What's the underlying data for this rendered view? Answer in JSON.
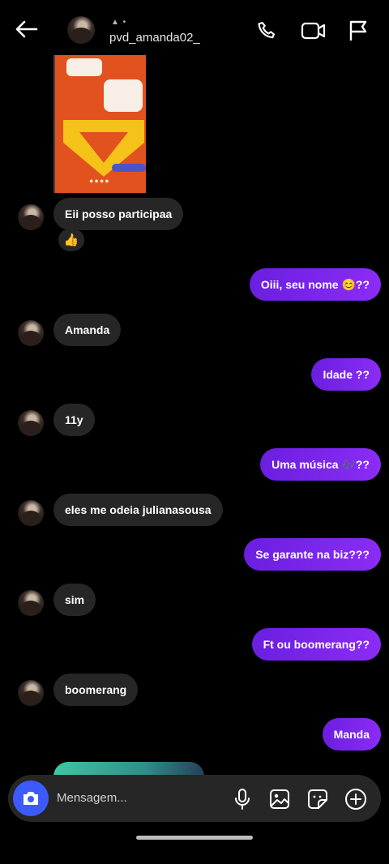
{
  "header": {
    "username": "pvd_amanda02_",
    "back_icon": "arrow-left-icon",
    "call_icon": "phone-icon",
    "video_icon": "video-camera-icon",
    "report_icon": "flag-icon"
  },
  "messages": [
    {
      "side": "in",
      "text": "Eii posso participaa",
      "reaction": "👍"
    },
    {
      "side": "out",
      "text": "Oiii, seu nome 😊??"
    },
    {
      "side": "in",
      "text": "Amanda"
    },
    {
      "side": "out",
      "text": "Idade ??"
    },
    {
      "side": "in",
      "text": "11y"
    },
    {
      "side": "out",
      "text": "Uma música 🎶??"
    },
    {
      "side": "in",
      "text": "eles me odeia julianasousa"
    },
    {
      "side": "out",
      "text": "Se garante na biz???"
    },
    {
      "side": "in",
      "text": "sim"
    },
    {
      "side": "out",
      "text": "Ft ou boomerang??"
    },
    {
      "side": "in",
      "text": "boomerang"
    },
    {
      "side": "out",
      "text": "Manda"
    }
  ],
  "composer": {
    "placeholder": "Mensagem...",
    "icons": [
      "camera-icon",
      "microphone-icon",
      "gallery-icon",
      "sticker-icon",
      "add-icon"
    ],
    "accent": "#3d5afe"
  },
  "colors": {
    "outgoing_bubble": "#7b26ec",
    "incoming_bubble": "#262626",
    "background": "#000000"
  }
}
